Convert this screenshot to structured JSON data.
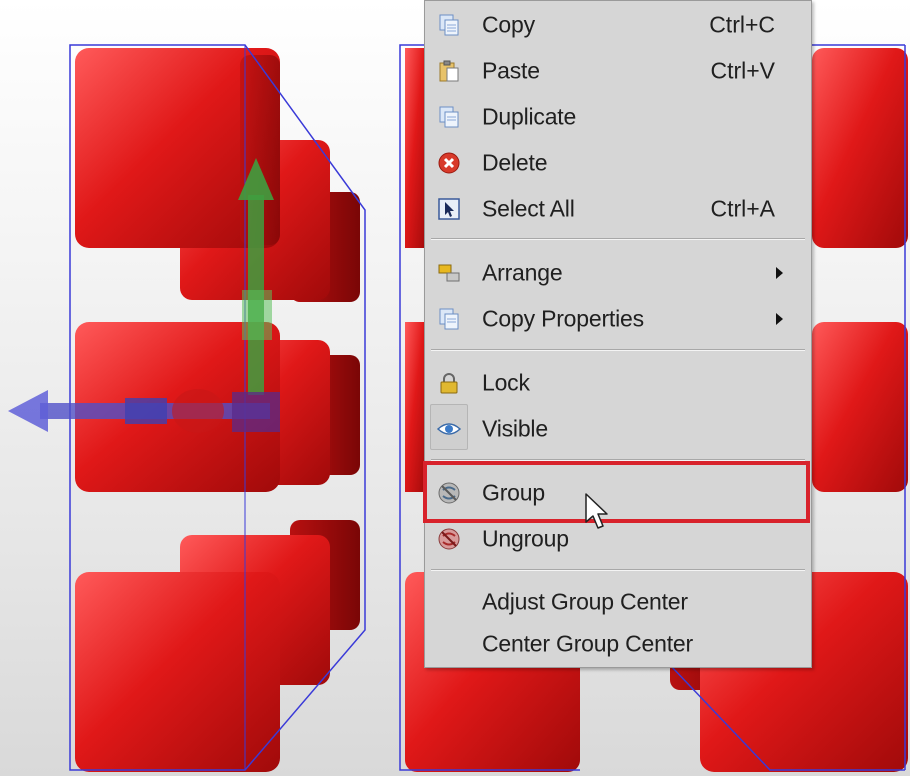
{
  "context_menu": {
    "items": [
      {
        "label": "Copy",
        "shortcut": "Ctrl+C",
        "icon": "copy-icon"
      },
      {
        "label": "Paste",
        "shortcut": "Ctrl+V",
        "icon": "paste-icon"
      },
      {
        "label": "Duplicate",
        "shortcut": "",
        "icon": "duplicate-icon"
      },
      {
        "label": "Delete",
        "shortcut": "",
        "icon": "delete-icon"
      },
      {
        "label": "Select All",
        "shortcut": "Ctrl+A",
        "icon": "select-all-icon"
      },
      {
        "label": "Arrange",
        "submenu": true,
        "icon": "arrange-icon"
      },
      {
        "label": "Copy Properties",
        "submenu": true,
        "icon": "copy-properties-icon"
      },
      {
        "label": "Lock",
        "icon": "lock-icon"
      },
      {
        "label": "Visible",
        "checked": true,
        "icon": "eye-icon"
      },
      {
        "label": "Group",
        "highlighted": true,
        "icon": "group-icon"
      },
      {
        "label": "Ungroup",
        "icon": "ungroup-icon"
      },
      {
        "label": "Adjust Group Center"
      },
      {
        "label": "Center Group Center"
      }
    ]
  },
  "colors": {
    "cube_red": "#d21414",
    "selection_blue": "#3a3ad8",
    "gizmo_green": "#3f9f3f",
    "gizmo_blue": "#5050c8",
    "callout_red": "#d8222b",
    "menu_bg": "#d6d6d6"
  }
}
